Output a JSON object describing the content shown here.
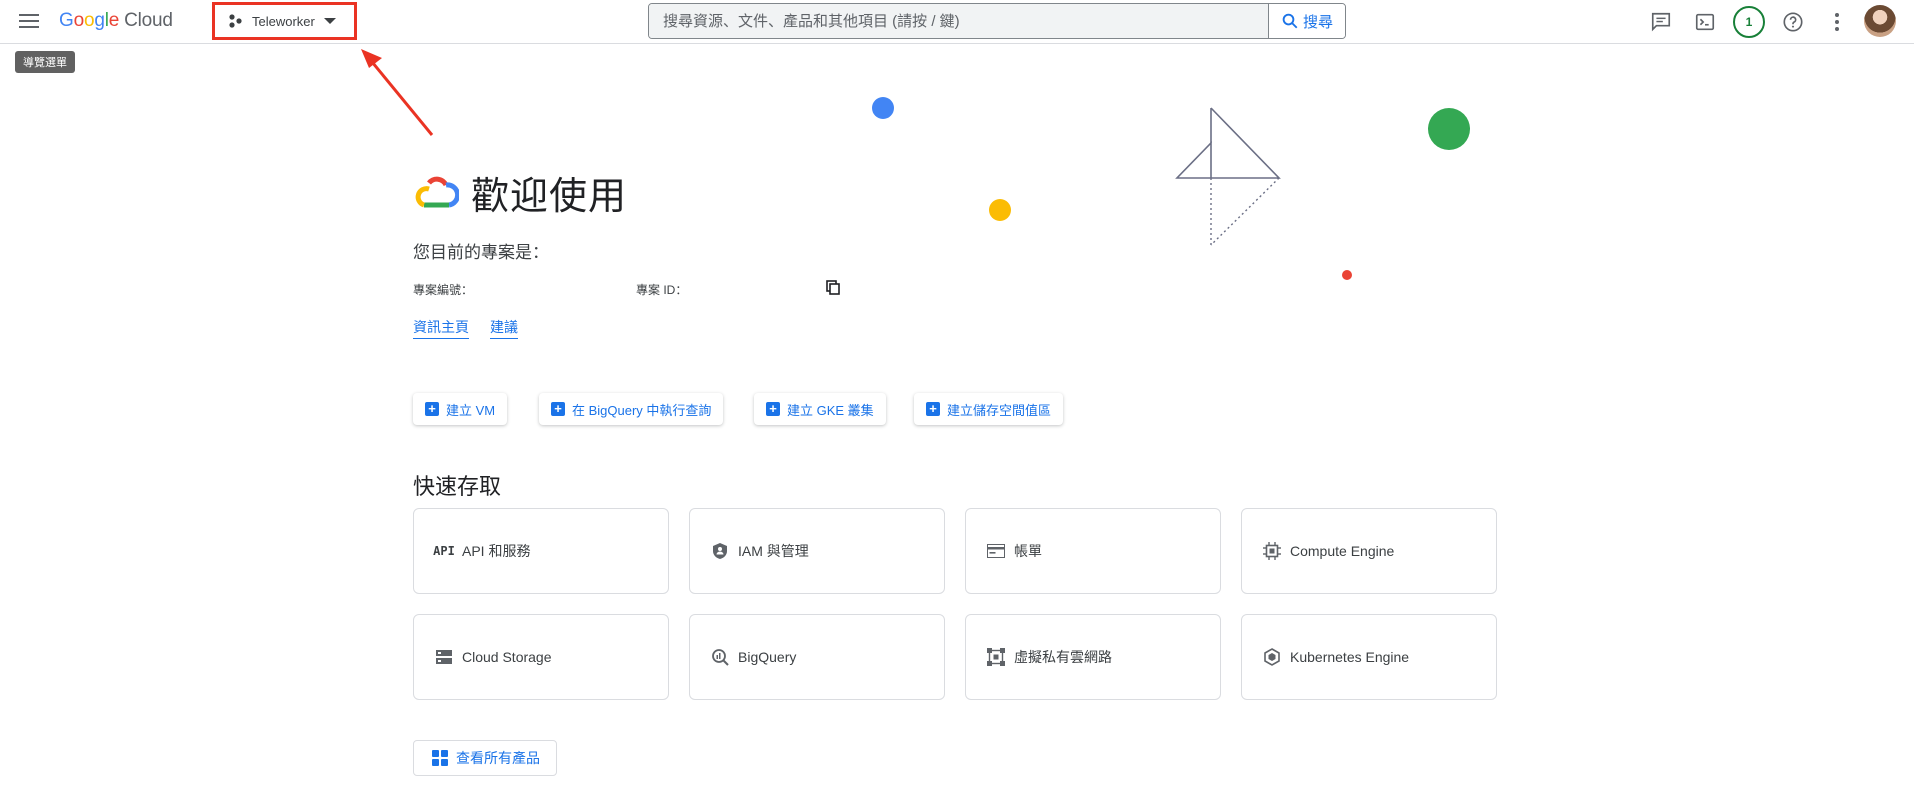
{
  "header": {
    "brand_google": "Google",
    "brand_cloud": "Cloud",
    "project_name": "Teleworker",
    "nav_tooltip": "導覽選單",
    "search_placeholder": "搜尋資源、文件、產品和其他項目 (請按 / 鍵)",
    "search_button": "搜尋",
    "notification_count": "1"
  },
  "welcome": {
    "title": "歡迎使用",
    "current_project_label": "您目前的專案是：",
    "project_number_label": "專案編號：",
    "project_id_label": "專案 ID："
  },
  "tabs": [
    "資訊主頁",
    "建議"
  ],
  "actions": [
    "建立 VM",
    "在 BigQuery 中執行查詢",
    "建立 GKE 叢集",
    "建立儲存空間值區"
  ],
  "quick_access": {
    "title": "快速存取",
    "cards": [
      {
        "label": "API 和服務",
        "icon": "api-icon"
      },
      {
        "label": "IAM 與管理",
        "icon": "shield-icon"
      },
      {
        "label": "帳單",
        "icon": "billing-icon"
      },
      {
        "label": "Compute Engine",
        "icon": "chip-icon"
      },
      {
        "label": "Cloud Storage",
        "icon": "storage-icon"
      },
      {
        "label": "BigQuery",
        "icon": "bigquery-icon"
      },
      {
        "label": "虛擬私有雲網路",
        "icon": "network-icon"
      },
      {
        "label": "Kubernetes Engine",
        "icon": "kubernetes-icon"
      }
    ]
  },
  "view_all_products": "查看所有產品",
  "colors": {
    "accent": "#1a73e8",
    "highlight_box": "#ea3323",
    "google_blue": "#4285f4",
    "google_red": "#ea4335",
    "google_yellow": "#fbbc04",
    "google_green": "#34a853"
  }
}
